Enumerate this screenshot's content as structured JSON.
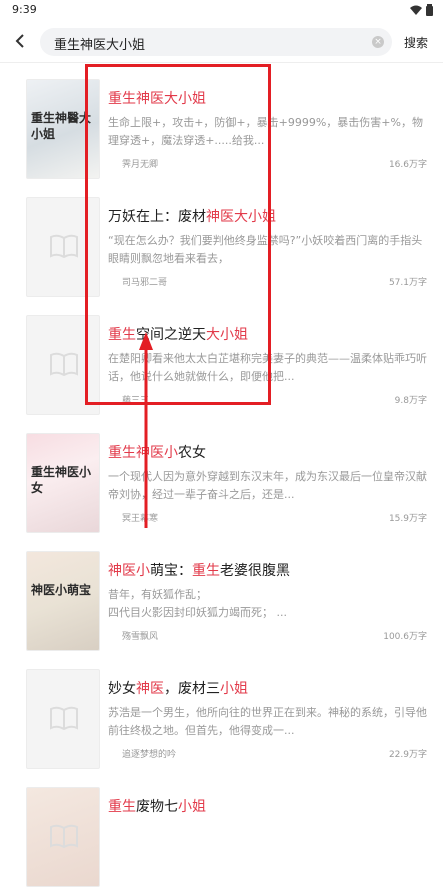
{
  "status": {
    "time": "9:39"
  },
  "search": {
    "query": "重生神医大小姐",
    "button": "搜索"
  },
  "results": [
    {
      "title_parts": [
        {
          "text": "重生神医大小姐",
          "hl": true
        }
      ],
      "desc": "生命上限+，攻击+，防御+，暴击+9999%，暴击伤害+%，物理穿透+，魔法穿透+.....给我...",
      "author": "霁月无卿",
      "count": "16.6万字",
      "cover": "重生神醫大小姐"
    },
    {
      "title_parts": [
        {
          "text": "万妖在上：废材",
          "hl": false
        },
        {
          "text": "神医大小姐",
          "hl": true
        }
      ],
      "desc": "“现在怎么办？我们要判他终身监禁吗?”小妖咬着西门离的手指头眼睛则飘忽地看来看去，",
      "author": "司马邪二哥",
      "count": "57.1万字",
      "cover": ""
    },
    {
      "title_parts": [
        {
          "text": "重生",
          "hl": true
        },
        {
          "text": "空间之逆天",
          "hl": false
        },
        {
          "text": "大小姐",
          "hl": true
        }
      ],
      "desc": "在楚阳卿看来他太太白芷堪称完美妻子的典范——温柔体贴乖巧听话，他说什么她就做什么，即便他把...",
      "author": "藤三三",
      "count": "9.8万字",
      "cover": ""
    },
    {
      "title_parts": [
        {
          "text": "重生神医小",
          "hl": true
        },
        {
          "text": "农女",
          "hl": false
        }
      ],
      "desc": "一个现代人因为意外穿越到东汉末年，成为东汉最后一位皇帝汉献帝刘协，经过一辈子奋斗之后，还是...",
      "author": "冥王幕寒",
      "count": "15.9万字",
      "cover": "重生神医小女"
    },
    {
      "title_parts": [
        {
          "text": "神医小",
          "hl": true
        },
        {
          "text": "萌宝：",
          "hl": false
        },
        {
          "text": "重生",
          "hl": true
        },
        {
          "text": "老婆很腹黑",
          "hl": false
        }
      ],
      "desc": "昔年，有妖狐作乱；\n四代目火影因封印妖狐力竭而死； ...",
      "author": "殇雪飘风",
      "count": "100.6万字",
      "cover": "神医小萌宝"
    },
    {
      "title_parts": [
        {
          "text": "妙女",
          "hl": false
        },
        {
          "text": "神医",
          "hl": true
        },
        {
          "text": "，废材三",
          "hl": false
        },
        {
          "text": "小姐",
          "hl": true
        }
      ],
      "desc": "苏浩是一个男生，他所向往的世界正在到来。神秘的系统，引导他前往终极之地。但首先，他得变成一...",
      "author": "追逐梦想的吟",
      "count": "22.9万字",
      "cover": ""
    },
    {
      "title_parts": [
        {
          "text": "重生",
          "hl": true
        },
        {
          "text": "废物七",
          "hl": false
        },
        {
          "text": "小姐",
          "hl": true
        }
      ],
      "desc": "",
      "author": "",
      "count": "",
      "cover": ""
    }
  ],
  "colors": {
    "highlight": "#e23a4a",
    "annotation": "#e31e24"
  }
}
